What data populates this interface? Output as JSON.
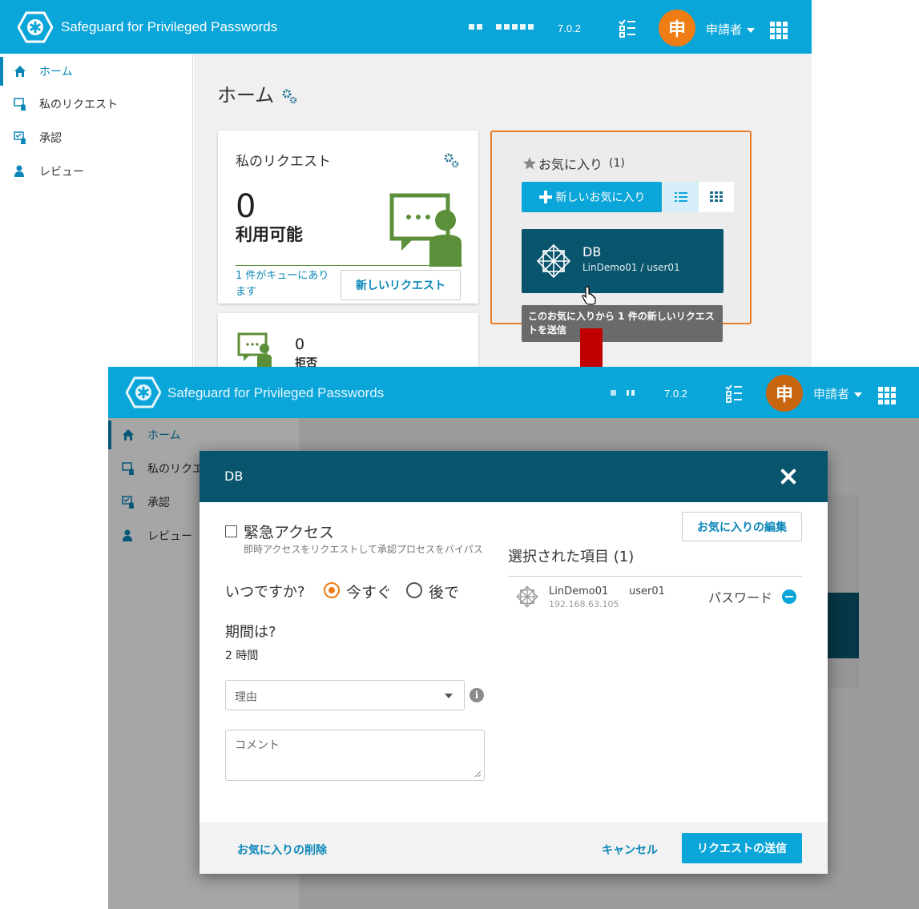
{
  "app": {
    "title": "Safeguard for Privileged Passwords",
    "version": "7.0.2",
    "user_initial": "申",
    "user_name": "申請者"
  },
  "sidebar": {
    "items": [
      {
        "label": "ホーム",
        "icon": "home-icon"
      },
      {
        "label": "私のリクエスト",
        "icon": "my-requests-icon"
      },
      {
        "label": "承認",
        "icon": "approvals-icon"
      },
      {
        "label": "レビュー",
        "icon": "review-icon"
      }
    ],
    "truncated_item": "私のリクエ"
  },
  "home": {
    "title": "ホーム",
    "requests_card": {
      "title": "私のリクエスト",
      "count": "0",
      "status": "利用可能",
      "queue_text": "1 件がキューにあります",
      "new_request_label": "新しいリクエスト"
    },
    "denied_card": {
      "count": "0",
      "label": "拒否"
    },
    "favorites": {
      "title": "お気に入り",
      "count_label": "(1)",
      "new_favorite_label": "新しいお気に入り",
      "tile_name": "DB",
      "tile_sub": "LinDemo01 / user01",
      "tooltip": "このお気に入りから 1 件の新しいリクエストを送信"
    }
  },
  "dialog": {
    "title": "DB",
    "emergency_label": "緊急アクセス",
    "emergency_hint": "即時アクセスをリクエストして承認プロセスをバイパス",
    "when_label": "いつですか?",
    "now_label": "今すぐ",
    "later_label": "後で",
    "duration_label": "期間は?",
    "duration_value": "2 時間",
    "reason_placeholder": "理由",
    "comment_placeholder": "コメント",
    "edit_favorite_label": "お気に入りの編集",
    "selected_label": "選択された項目 (1)",
    "selected_item": {
      "asset": "LinDemo01",
      "ip": "192.168.63.105",
      "account": "user01",
      "type": "パスワード"
    },
    "delete_favorite_label": "お気に入りの削除",
    "cancel_label": "キャンセル",
    "submit_label": "リクエストの送信"
  },
  "colors": {
    "topbar": "#0aa5d9",
    "dialog_header": "#0a556e",
    "avatar": "#ef7d14",
    "accent_link": "#0a86b8",
    "highlight_border": "#e87d2a",
    "arrow": "#c00000",
    "illustration_green": "#5c8f3a"
  }
}
